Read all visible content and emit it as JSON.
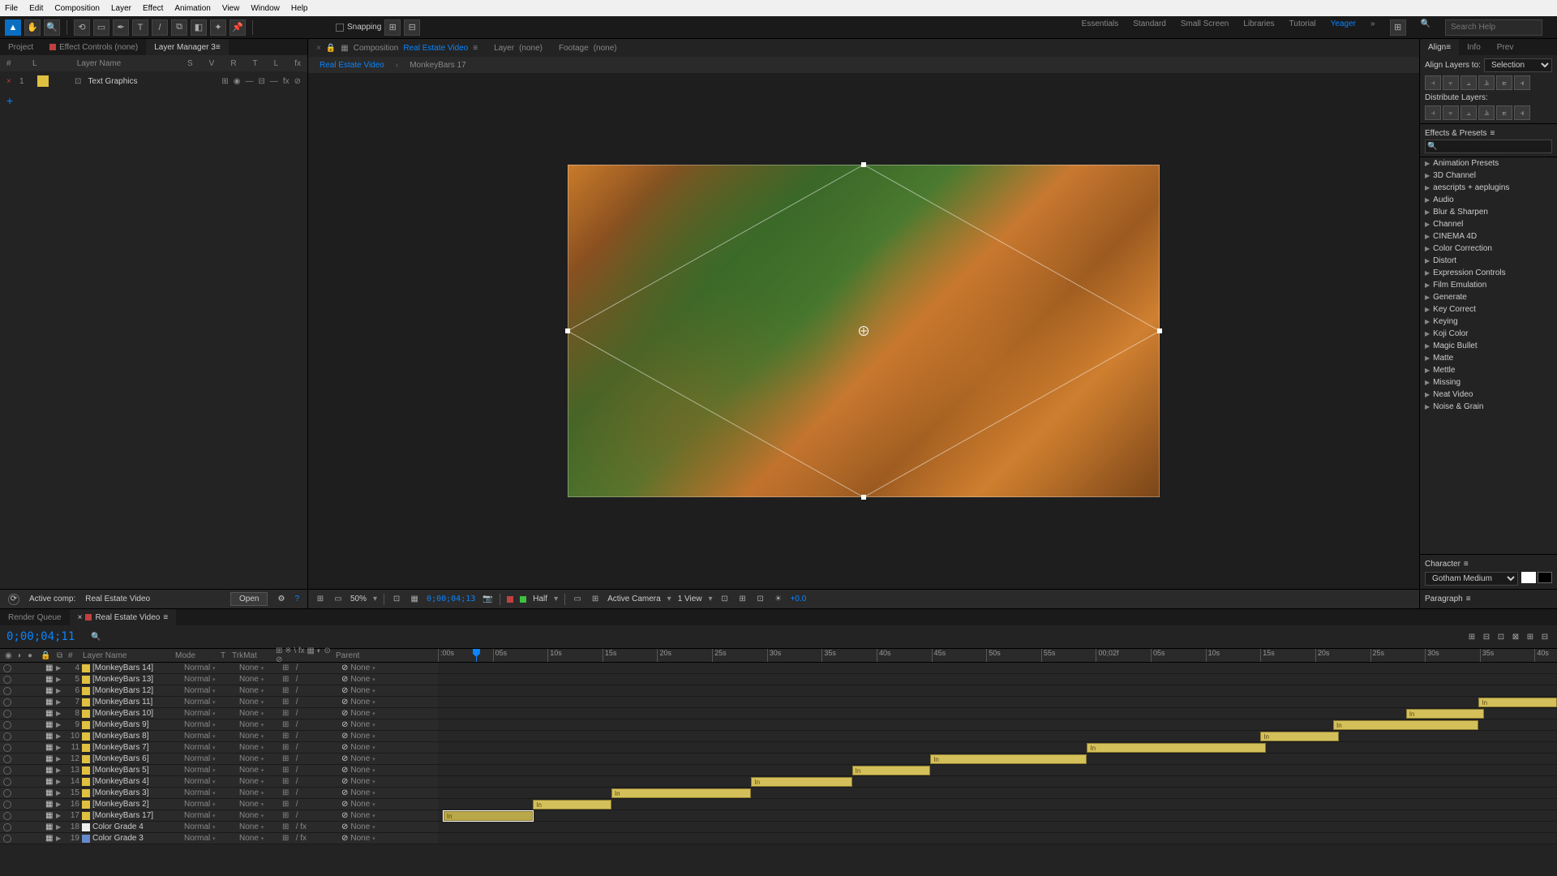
{
  "menu": [
    "File",
    "Edit",
    "Composition",
    "Layer",
    "Effect",
    "Animation",
    "View",
    "Window",
    "Help"
  ],
  "toolbar": {
    "snapping": "Snapping"
  },
  "workspaces": [
    "Essentials",
    "Standard",
    "Small Screen",
    "Libraries",
    "Tutorial",
    "Yeager"
  ],
  "active_workspace": "Yeager",
  "search_placeholder": "Search Help",
  "left": {
    "tabs": [
      "Project",
      "Effect Controls (none)",
      "Layer Manager 3"
    ],
    "active_tab": "Layer Manager 3",
    "cols": [
      "#",
      "L",
      "Layer Name",
      "S",
      "V",
      "R",
      "T",
      "L",
      "fx"
    ],
    "row": {
      "idx": "1",
      "name": "Text Graphics"
    },
    "active_comp_label": "Active comp:",
    "active_comp": "Real Estate Video",
    "open": "Open"
  },
  "comp": {
    "tabs": [
      {
        "type": "Composition",
        "name": "Real Estate Video"
      },
      {
        "type": "Layer",
        "name": "(none)"
      },
      {
        "type": "Footage",
        "name": "(none)"
      }
    ],
    "subtabs": [
      "Real Estate Video",
      "MonkeyBars 17"
    ],
    "active_subtab": "Real Estate Video"
  },
  "viewer_ctrl": {
    "zoom": "50%",
    "tc": "0;00;04;13",
    "res": "Half",
    "cam": "Active Camera",
    "view": "1 View",
    "exp": "+0.0"
  },
  "align": {
    "title": "Align",
    "info": "Info",
    "prev": "Prev",
    "layers_to": "Align Layers to:",
    "sel": "Selection",
    "dist": "Distribute Layers:"
  },
  "fx": {
    "title": "Effects & Presets",
    "items": [
      "Animation Presets",
      "3D Channel",
      "aescripts + aeplugins",
      "Audio",
      "Blur & Sharpen",
      "Channel",
      "CINEMA 4D",
      "Color Correction",
      "Distort",
      "Expression Controls",
      "Film Emulation",
      "Generate",
      "Key Correct",
      "Keying",
      "Koji Color",
      "Magic Bullet",
      "Matte",
      "Mettle",
      "Missing",
      "Neat Video",
      "Noise & Grain"
    ]
  },
  "char": {
    "title": "Character",
    "font": "Gotham Medium"
  },
  "para": {
    "title": "Paragraph"
  },
  "timeline": {
    "tabs": [
      "Render Queue",
      "Real Estate Video"
    ],
    "active_tab": "Real Estate Video",
    "timecode": "0;00;04;11",
    "cols": {
      "layer": "Layer Name",
      "mode": "Mode",
      "trkmat": "TrkMat",
      "parent": "Parent"
    },
    "ticks": [
      ":00s",
      "05s",
      "10s",
      "15s",
      "20s",
      "25s",
      "30s",
      "35s",
      "40s",
      "45s",
      "50s",
      "55s",
      "00;02f",
      "05s",
      "10s",
      "15s",
      "20s",
      "25s",
      "30s",
      "35s",
      "40s"
    ],
    "playhead_pc": 3.4,
    "rows": [
      {
        "idx": 4,
        "name": "[MonkeyBars 14]",
        "color": "#e0c040",
        "mode": "Normal",
        "trk": "None",
        "parent": "None",
        "bar": null
      },
      {
        "idx": 5,
        "name": "[MonkeyBars 13]",
        "color": "#e0c040",
        "mode": "Normal",
        "trk": "None",
        "parent": "None",
        "bar": null
      },
      {
        "idx": 6,
        "name": "[MonkeyBars 12]",
        "color": "#e0c040",
        "mode": "Normal",
        "trk": "None",
        "parent": "None",
        "bar": null
      },
      {
        "idx": 7,
        "name": "[MonkeyBars 11]",
        "color": "#e0c040",
        "mode": "Normal",
        "trk": "None",
        "parent": "None",
        "bar": {
          "l": 93,
          "w": 7
        }
      },
      {
        "idx": 8,
        "name": "[MonkeyBars 10]",
        "color": "#e0c040",
        "mode": "Normal",
        "trk": "None",
        "parent": "None",
        "bar": {
          "l": 86.5,
          "w": 7
        }
      },
      {
        "idx": 9,
        "name": "[MonkeyBars 9]",
        "color": "#e0c040",
        "mode": "Normal",
        "trk": "None",
        "parent": "None",
        "bar": {
          "l": 80,
          "w": 13
        }
      },
      {
        "idx": 10,
        "name": "[MonkeyBars 8]",
        "color": "#e0c040",
        "mode": "Normal",
        "trk": "None",
        "parent": "None",
        "bar": {
          "l": 73.5,
          "w": 7
        }
      },
      {
        "idx": 11,
        "name": "[MonkeyBars 7]",
        "color": "#e0c040",
        "mode": "Normal",
        "trk": "None",
        "parent": "None",
        "bar": {
          "l": 58,
          "w": 16
        }
      },
      {
        "idx": 12,
        "name": "[MonkeyBars 6]",
        "color": "#e0c040",
        "mode": "Normal",
        "trk": "None",
        "parent": "None",
        "bar": {
          "l": 44,
          "w": 14
        }
      },
      {
        "idx": 13,
        "name": "[MonkeyBars 5]",
        "color": "#e0c040",
        "mode": "Normal",
        "trk": "None",
        "parent": "None",
        "bar": {
          "l": 37,
          "w": 7
        }
      },
      {
        "idx": 14,
        "name": "[MonkeyBars 4]",
        "color": "#e0c040",
        "mode": "Normal",
        "trk": "None",
        "parent": "None",
        "bar": {
          "l": 28,
          "w": 9
        }
      },
      {
        "idx": 15,
        "name": "[MonkeyBars 3]",
        "color": "#e0c040",
        "mode": "Normal",
        "trk": "None",
        "parent": "None",
        "bar": {
          "l": 15.5,
          "w": 12.5
        }
      },
      {
        "idx": 16,
        "name": "[MonkeyBars 2]",
        "color": "#e0c040",
        "mode": "Normal",
        "trk": "None",
        "parent": "None",
        "bar": {
          "l": 8.5,
          "w": 7
        }
      },
      {
        "idx": 17,
        "name": "[MonkeyBars 17]",
        "color": "#e0c040",
        "mode": "Normal",
        "trk": "None",
        "parent": "None",
        "bar": {
          "l": 0.5,
          "w": 8
        },
        "sel": true
      },
      {
        "idx": 18,
        "name": "Color Grade 4",
        "color": "#eeeeee",
        "mode": "Normal",
        "trk": "None",
        "parent": "None",
        "bar": null,
        "fx": true
      },
      {
        "idx": 19,
        "name": "Color Grade 3",
        "color": "#6688cc",
        "mode": "Normal",
        "trk": "None",
        "parent": "None",
        "bar": null,
        "fx": true
      }
    ]
  }
}
